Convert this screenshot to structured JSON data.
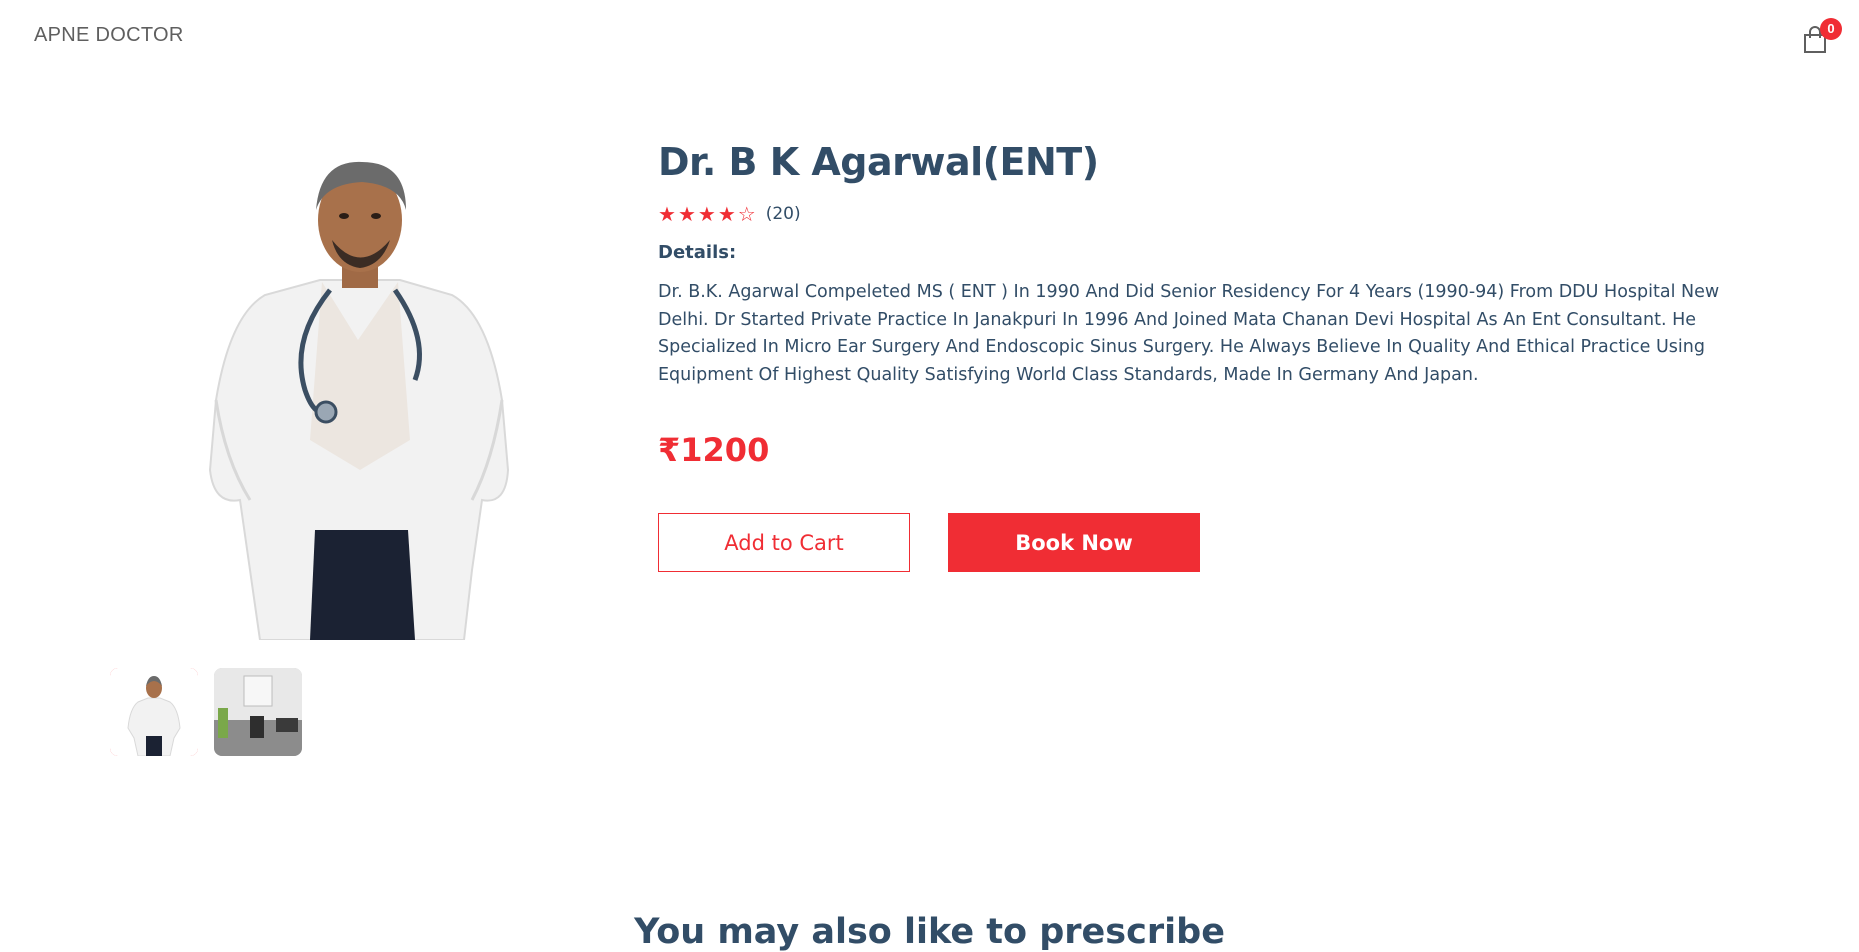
{
  "navbar": {
    "logo": "APNE DOCTOR",
    "cart_icon": "shopping-bag-icon",
    "cart_count": "0"
  },
  "product": {
    "name": "Dr. B K Agarwal(ENT)",
    "rating": 4,
    "rating_max": 5,
    "reviews_count": "(20)",
    "details_label": "Details:",
    "details": "Dr. B.K. Agarwal Compeleted MS ( ENT ) In 1990 And Did Senior Residency For 4 Years (1990-94) From DDU Hospital New Delhi. Dr Started Private Practice In Janakpuri In 1996 And Joined Mata Chanan Devi Hospital As An Ent Consultant. He Specialized In Micro Ear Surgery And Endoscopic Sinus Surgery. He Always Believe In Quality And Ethical Practice Using Equipment Of Highest Quality Satisfying World Class Standards, Made In Germany And Japan.",
    "price": "₹1200",
    "add_to_cart_label": "Add to Cart",
    "buy_now_label": "Book Now",
    "main_image": "doctor-photo",
    "thumbnails": [
      {
        "name": "doctor-photo",
        "selected": true
      },
      {
        "name": "clinic-room-photo",
        "selected": false
      }
    ]
  },
  "suggestions": {
    "heading": "You may also like to prescribe"
  },
  "colors": {
    "accent": "#f02d34",
    "text": "#324d67",
    "logo": "#5f5f5f"
  }
}
